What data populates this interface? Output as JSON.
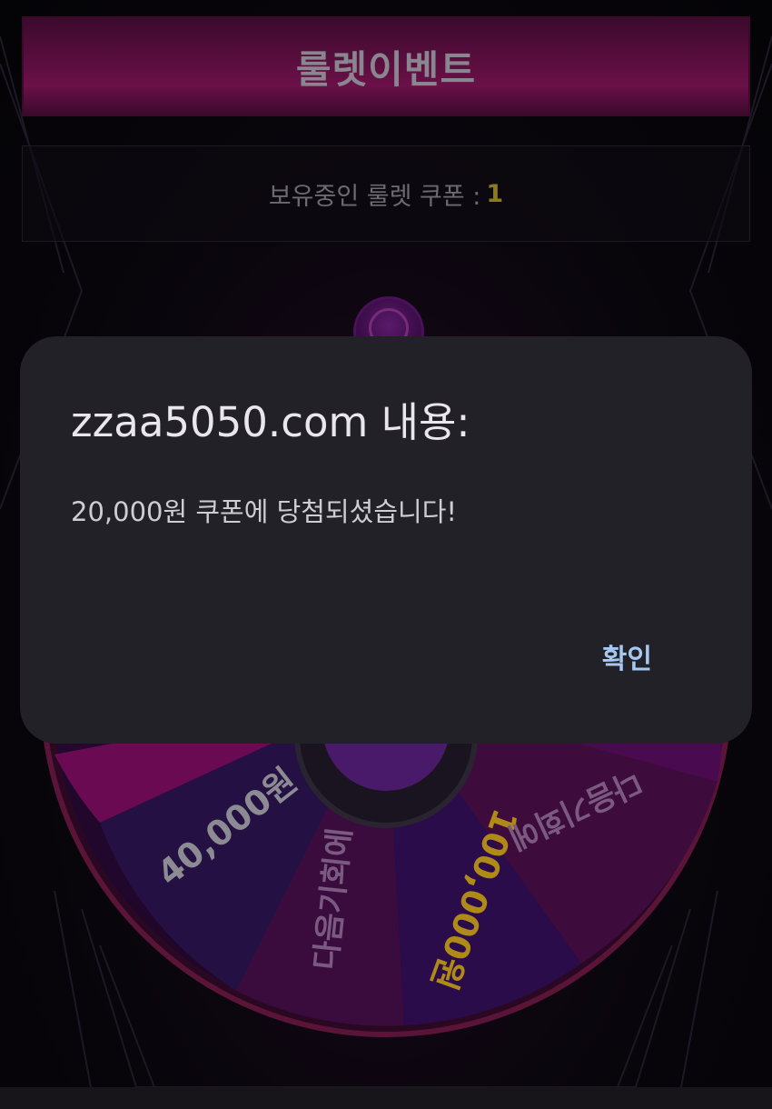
{
  "header": {
    "title": "룰렛이벤트"
  },
  "coupon": {
    "label": "보유중인 룰렛 쿠폰 :",
    "count": "1"
  },
  "wheel": {
    "segments": [
      {
        "label": "40,000원",
        "color": "#8c8a92"
      },
      {
        "label": "다음기회에",
        "color": "#7a5a80"
      },
      {
        "label": "100,000원",
        "color": "#b08a18"
      },
      {
        "label": "다음기회에",
        "color": "#7a5a80"
      }
    ]
  },
  "dialog": {
    "title": "zzaa5050.com 내용:",
    "message": "20,000원 쿠폰에 당첨되셨습니다!",
    "ok_label": "확인"
  },
  "colors": {
    "accent_magenta": "#6a1048",
    "dialog_bg": "#222127",
    "ok_text": "#a6c8f0",
    "coupon_count": "#8a7a20"
  }
}
